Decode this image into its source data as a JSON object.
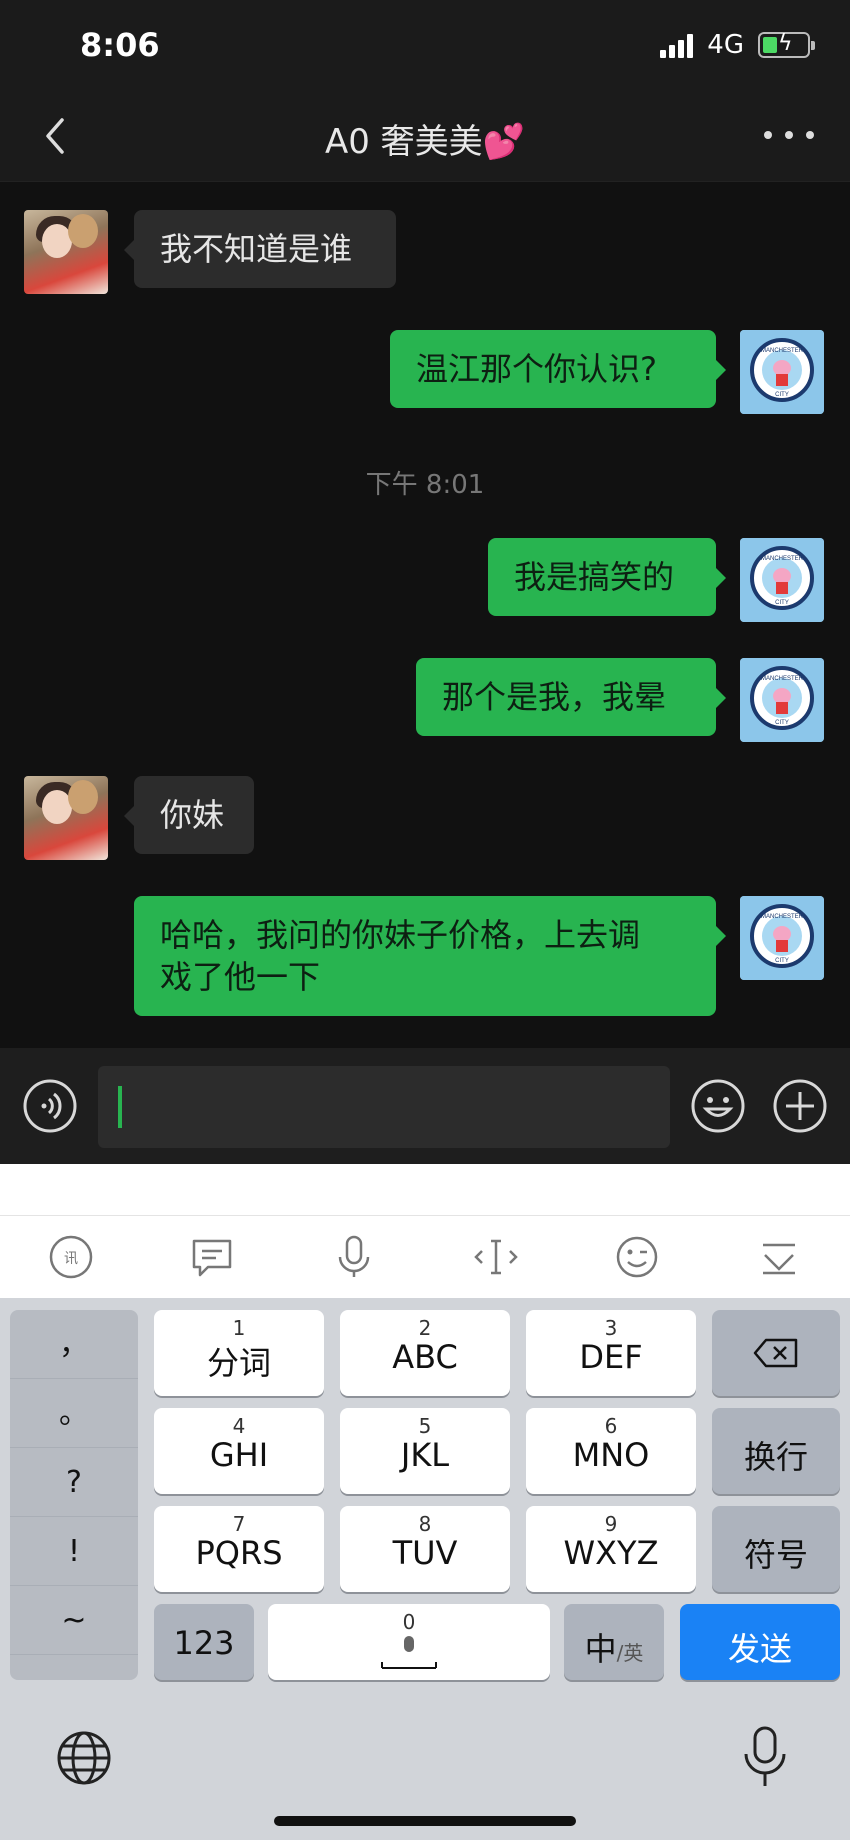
{
  "status": {
    "time": "8:06",
    "network": "4G"
  },
  "navbar": {
    "title": "A0 奢美美💕"
  },
  "messages": [
    {
      "side": "in",
      "text": "我不知道是谁"
    },
    {
      "side": "out",
      "text": "温江那个你认识?"
    },
    {
      "type": "time",
      "text": "下午 8:01"
    },
    {
      "side": "out",
      "text": "我是搞笑的"
    },
    {
      "side": "out",
      "text": "那个是我，我晕"
    },
    {
      "side": "in",
      "text": "你妹"
    },
    {
      "side": "out",
      "text": "哈哈，我问的你妹子价格，上去调\n戏了他一下"
    }
  ],
  "avatars": {
    "self_badge_top": "MANCHESTER",
    "self_badge_bottom": "CITY"
  },
  "keyboard": {
    "punct": [
      "，",
      "。",
      "?",
      "!",
      "~"
    ],
    "keys": [
      {
        "num": "1",
        "label": "分词"
      },
      {
        "num": "2",
        "label": "ABC"
      },
      {
        "num": "3",
        "label": "DEF"
      },
      {
        "num": "4",
        "label": "GHI"
      },
      {
        "num": "5",
        "label": "JKL"
      },
      {
        "num": "6",
        "label": "MNO"
      },
      {
        "num": "7",
        "label": "PQRS"
      },
      {
        "num": "8",
        "label": "TUV"
      },
      {
        "num": "9",
        "label": "WXYZ"
      }
    ],
    "newline": "换行",
    "symbols": "符号",
    "num_mode": "123",
    "space_num": "0",
    "lang": "中",
    "lang_sub": "/英",
    "send": "发送"
  },
  "colors": {
    "accent_green": "#28b450",
    "send_blue": "#1a82f5"
  }
}
